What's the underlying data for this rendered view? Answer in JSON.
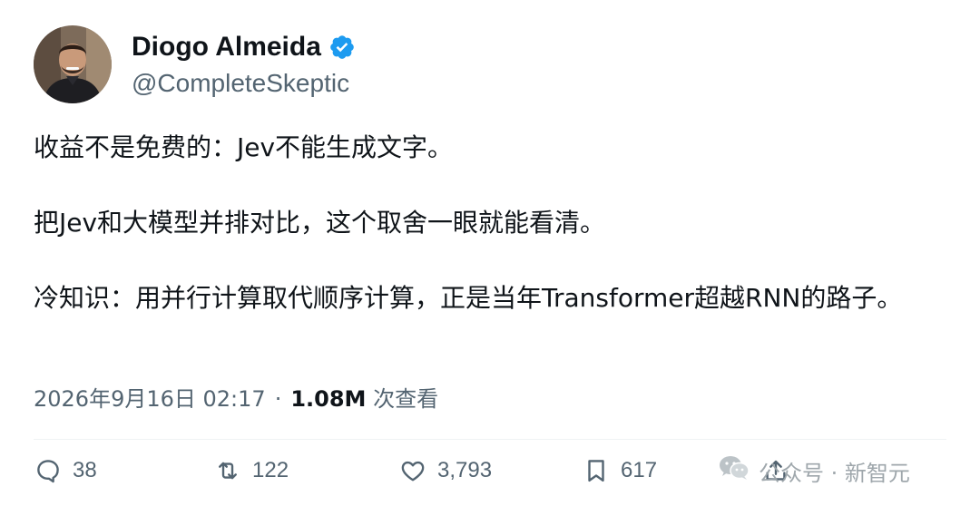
{
  "author": {
    "display_name": "Diogo Almeida",
    "handle": "@CompleteSkeptic",
    "verified": true,
    "verified_color": "#1d9bf0"
  },
  "tweet": {
    "paragraphs": [
      "收益不是免费的：Jev不能生成文字。",
      "把Jev和大模型并排对比，这个取舍一眼就能看清。",
      "冷知识：用并行计算取代顺序计算，正是当年Transformer超越RNN的路子。"
    ]
  },
  "meta": {
    "timestamp": "2026年9月16日 02:17",
    "separator": "·",
    "views_count": "1.08M",
    "views_label": "次查看"
  },
  "actions": {
    "replies": "38",
    "retweets": "122",
    "likes": "3,793",
    "bookmarks": "617"
  },
  "watermark": {
    "text": "公众号 · 新智元",
    "icon": "wechat-icon"
  },
  "colors": {
    "text_primary": "#0f1419",
    "text_secondary": "#536471",
    "divider": "#eff3f4"
  }
}
